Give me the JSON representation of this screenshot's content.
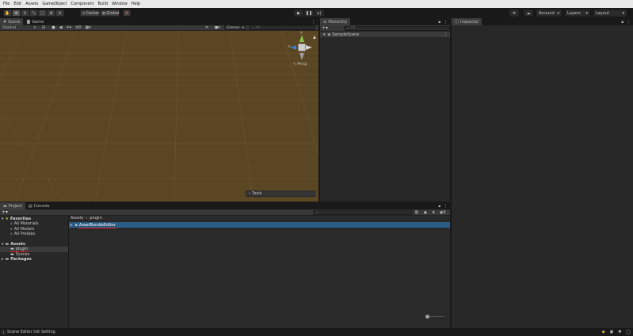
{
  "menu": [
    "File",
    "Edit",
    "Assets",
    "GameObject",
    "Component",
    "Build",
    "Window",
    "Help"
  ],
  "toolbar": {
    "pivot_label": "Center",
    "space_label": "Global",
    "account_label": "Account",
    "layers_label": "Layers",
    "layout_label": "Layout"
  },
  "scene": {
    "tabs": [
      "Scene",
      "Game"
    ],
    "shading": "Shaded",
    "gizmos": "Gizmos",
    "search_placeholder": "All",
    "view_label": "< Persp",
    "axis_y": "y",
    "axis_z": "z",
    "tools_label": "Tools"
  },
  "hierarchy": {
    "tab": "Hierarchy",
    "search_placeholder": "All",
    "scene_name": "SampleScene"
  },
  "inspector": {
    "tab": "Inspector"
  },
  "project": {
    "tabs": [
      "Project",
      "Console"
    ],
    "hidden_count": "9",
    "favorites": {
      "label": "Favorites",
      "items": [
        "All Materials",
        "All Models",
        "All Prefabs"
      ]
    },
    "assets": {
      "label": "Assets",
      "items": [
        "plugin",
        "Scenes"
      ]
    },
    "packages_label": "Packages",
    "breadcrumb": [
      "Assets",
      "plugin"
    ],
    "files": [
      "AssetBundleEditor"
    ]
  },
  "status": {
    "message": "Scene Editor Init Setting"
  },
  "colors": {
    "scene_bg": "#5a4622",
    "selection": "#2c5d87",
    "underline": "#e0201d",
    "folder": "#c8c8c8"
  }
}
